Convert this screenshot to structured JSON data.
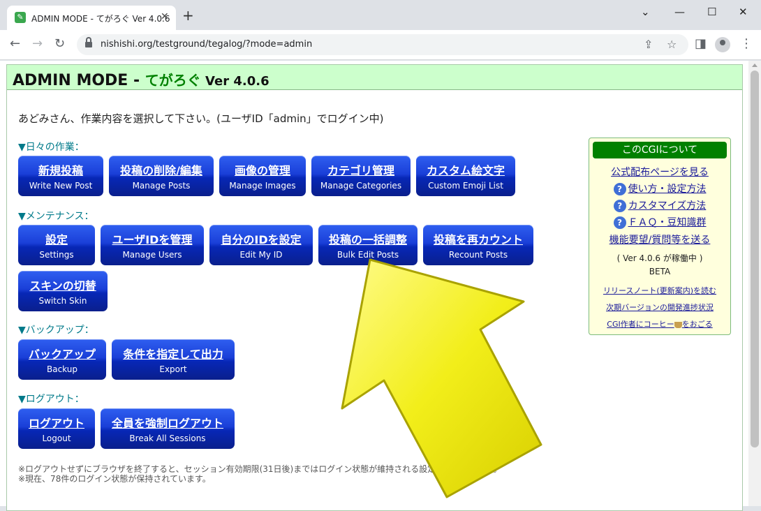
{
  "browser": {
    "tab_title": "ADMIN MODE - てがろぐ Ver 4.0.6",
    "tab_close": "✕",
    "new_tab": "+",
    "url": "nishishi.org/testground/tegalog/?mode=admin",
    "win_min": "—",
    "win_max": "☐",
    "win_close": "✕"
  },
  "header": {
    "prefix": "ADMIN MODE - ",
    "app": "てがろぐ",
    "version": " Ver 4.0.6"
  },
  "welcome": "あどみさん、作業内容を選択して下さい。(ユーザID「admin」でログイン中)",
  "sections": {
    "daily": {
      "label": "▼日々の作業：",
      "buttons": [
        {
          "jp": "新規投稿",
          "en": "Write New Post"
        },
        {
          "jp": "投稿の削除/編集",
          "en": "Manage Posts"
        },
        {
          "jp": "画像の管理",
          "en": "Manage Images"
        },
        {
          "jp": "カテゴリ管理",
          "en": "Manage Categories"
        },
        {
          "jp": "カスタム絵文字",
          "en": "Custom Emoji List"
        }
      ]
    },
    "maintenance": {
      "label": "▼メンテナンス：",
      "buttons": [
        {
          "jp": "設定",
          "en": "Settings"
        },
        {
          "jp": "ユーザIDを管理",
          "en": "Manage Users"
        },
        {
          "jp": "自分のIDを設定",
          "en": "Edit My ID"
        },
        {
          "jp": "投稿の一括調整",
          "en": "Bulk Edit Posts"
        },
        {
          "jp": "投稿を再カウント",
          "en": "Recount Posts"
        },
        {
          "jp": "スキンの切替",
          "en": "Switch Skin"
        }
      ]
    },
    "backup": {
      "label": "▼バックアップ：",
      "buttons": [
        {
          "jp": "バックアップ",
          "en": "Backup"
        },
        {
          "jp": "条件を指定して出力",
          "en": "Export"
        }
      ]
    },
    "logout": {
      "label": "▼ログアウト：",
      "buttons": [
        {
          "jp": "ログアウト",
          "en": "Logout"
        },
        {
          "jp": "全員を強制ログアウト",
          "en": "Break All Sessions"
        }
      ]
    }
  },
  "notes": [
    "※ログアウトせずにブラウザを終了すると、セッション有効期限(31日後)まではログイン状態が維持される設定になっています。",
    "※現在、78件のログイン状態が保持されています。"
  ],
  "sidebox": {
    "title": "このCGIについて",
    "official": "公式配布ページを見る",
    "usage": "使い方・設定方法",
    "customize": "カスタマイズ方法",
    "faq": "ＦＡＱ・豆知識群",
    "request": "機能要望/質問等を送る",
    "running": "( Ver 4.0.6 が稼働中 )",
    "beta": "BETA",
    "release_notes": "リリースノート(更新案内)を読む",
    "next_version": "次期バージョンの開発進捗状況",
    "coffee_prefix": "CGI作者にコーヒー",
    "coffee_suffix": "をおごる",
    "q_mark": "?"
  },
  "colors": {
    "header_bg": "#ccffcc",
    "button_blue": "#1a3fd8",
    "section_label": "#007a8a",
    "sidebox_bg": "#ffffdd",
    "sidebox_title_bg": "#008000",
    "arrow_yellow": "#f2ee1a"
  },
  "icons": {
    "back": "arrow-left-icon",
    "forward": "arrow-right-icon",
    "reload": "reload-icon",
    "lock": "lock-icon",
    "share": "share-icon",
    "star": "star-icon",
    "sidepanel": "side-panel-icon",
    "profile": "profile-icon",
    "menu": "kebab-menu-icon",
    "pointer": "yellow-arrow-icon"
  }
}
